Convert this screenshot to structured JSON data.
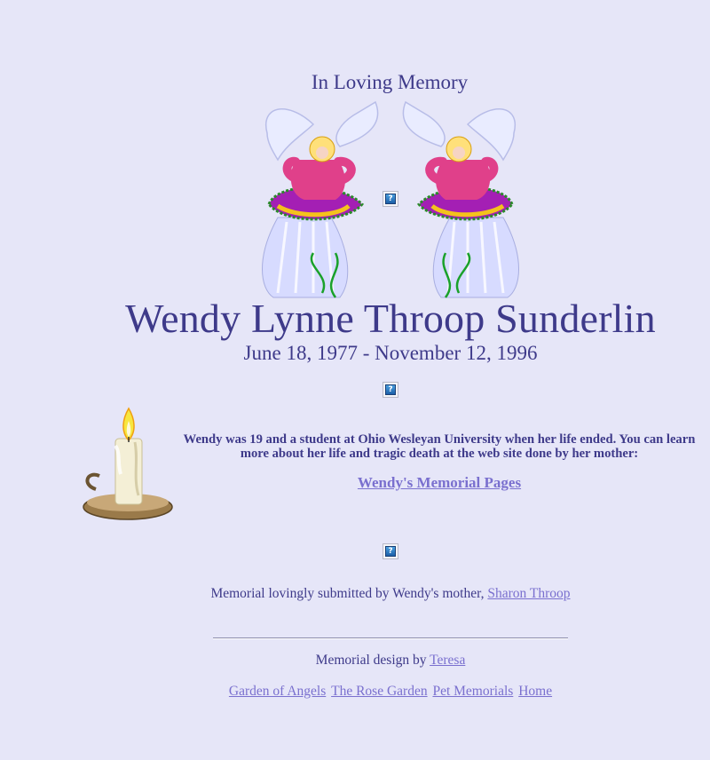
{
  "header": {
    "title": "In Loving Memory"
  },
  "memorial": {
    "name": "Wendy Lynne Throop Sunderlin",
    "dates": "June 18, 1977 - November 12, 1996",
    "paragraph": "Wendy was 19 and a student at Ohio Wesleyan University when her life ended. You can learn more about her life and tragic death at the web site done by her mother:",
    "memorial_link": "Wendy's Memorial Pages"
  },
  "submission": {
    "text": "Memorial lovingly submitted by Wendy's mother, ",
    "author_link": "Sharon Throop"
  },
  "credits": {
    "text": "Memorial design by ",
    "designer_link": "Teresa"
  },
  "footer": {
    "links": [
      "Garden of Angels",
      "The Rose Garden",
      "Pet Memorials",
      "Home"
    ]
  },
  "icons": {
    "angel_left": "angel-icon",
    "angel_right": "angel-icon",
    "candle": "candle-icon",
    "broken_image": "broken-image-icon"
  },
  "colors": {
    "background": "#e6e6f8",
    "text": "#3e3a8a",
    "link": "#7a70cf"
  }
}
